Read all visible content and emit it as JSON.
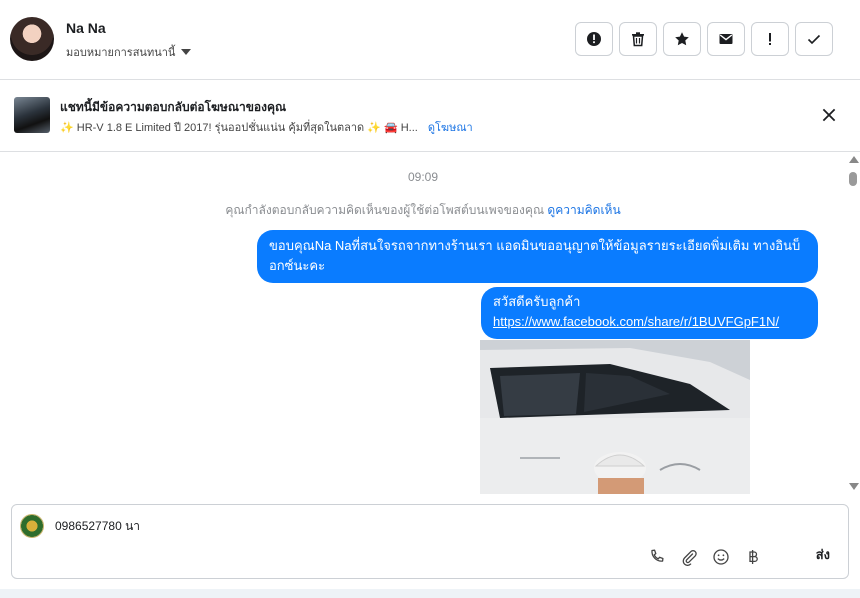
{
  "header": {
    "name": "Na Na",
    "assign_label": "มอบหมายการสนทนานี้",
    "actions": [
      {
        "icon": "alert-circle-icon",
        "name": "spam-button"
      },
      {
        "icon": "trash-icon",
        "name": "delete-button"
      },
      {
        "icon": "star-icon",
        "name": "star-button"
      },
      {
        "icon": "mail-icon",
        "name": "mark-unread-button"
      },
      {
        "icon": "exclamation-icon",
        "name": "follow-up-button"
      },
      {
        "icon": "check-icon",
        "name": "mark-done-button"
      }
    ]
  },
  "ad": {
    "title": "แชทนี้มีข้อความตอบกลับต่อโฆษณาของคุณ",
    "subtitle": "✨ HR-V 1.8 E Limited ปี 2017! รุ่นออปชั่นแน่น คุ้มที่สุดในตลาด ✨ 🚘 H...",
    "link": "ดูโฆษณา"
  },
  "conversation": {
    "time": "09:09",
    "notice": "คุณกำลังตอบกลับความคิดเห็นของผู้ใช้ต่อโพสต์บนเพจของคุณ",
    "notice_link": "ดูความคิดเห็น",
    "messages": [
      {
        "text": "ขอบคุณNa Naที่สนใจรถจากทางร้านเรา แอดมินขออนุญาตให้ข้อมูลรายระเอียดพิ่มเติม ทางอินบ็อกซ์นะคะ"
      },
      {
        "text": "สวัสดีครับลูกค้า",
        "link": "https://www.facebook.com/share/r/1BUVFGpF1N/"
      }
    ]
  },
  "composer": {
    "value": "0986527780 นา",
    "send_label": "ส่ง",
    "tools": [
      "phone-icon",
      "paperclip-icon",
      "emoji-icon",
      "baht-icon"
    ]
  },
  "colors": {
    "accent": "#0a7cff",
    "link": "#1b74e4",
    "muted": "#8a8d91"
  }
}
